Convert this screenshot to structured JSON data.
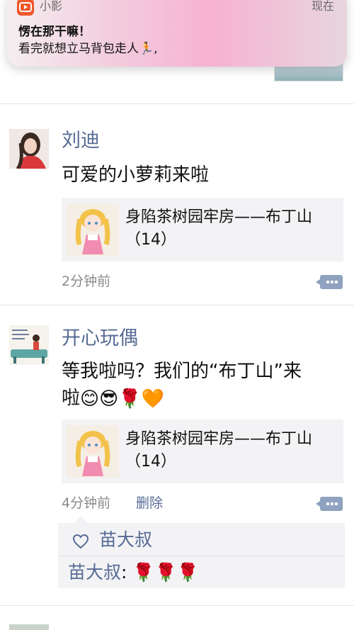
{
  "notification": {
    "app_name": "小影",
    "time": "现在",
    "title": "愣在那干嘛！",
    "body": "看完就想立马背包走人🏃,"
  },
  "posts": [
    {
      "username": "刘迪",
      "text": "可爱的小萝莉来啦",
      "link_title": "身陷茶树园牢房——布丁山（14）",
      "time": "2分钟前"
    },
    {
      "username": "开心玩偶",
      "text_line1": "等我啦吗？我们的“布丁山”来",
      "text_line2": "啦",
      "emojis": [
        "😊",
        "😎",
        "🌹",
        "🧡"
      ],
      "link_title": "身陷茶树园牢房——布丁山（14）",
      "time": "4分钟前",
      "delete_label": "删除",
      "likes": [
        "苗大叔"
      ],
      "comments": [
        {
          "author": "苗大叔",
          "separator": ":",
          "text": "🌹🌹🌹"
        }
      ]
    }
  ],
  "colors": {
    "link_blue": "#576b95",
    "time_gray": "#8a8a8a",
    "card_bg": "#f3f3f5",
    "notification_icon": "#f0572b"
  }
}
